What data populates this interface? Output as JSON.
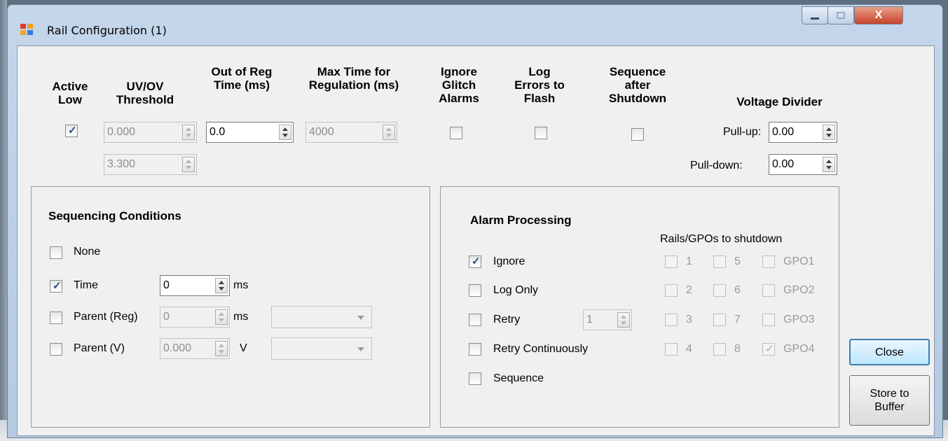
{
  "window": {
    "title": "Rail Configuration (1)",
    "close_glyph": "X"
  },
  "headers": {
    "active_low": "Active Low",
    "uv_ov": "UV/OV Threshold",
    "out_of_reg": "Out of Reg Time (ms)",
    "max_time": "Max Time for Regulation (ms)",
    "ignore_glitch": "Ignore Glitch Alarms",
    "log_errors": "Log Errors to Flash",
    "seq_after": "Sequence after Shutdown",
    "voltage_divider": "Voltage Divider"
  },
  "top_row": {
    "active_low_checked": true,
    "uv_value": "0.000",
    "ov_value": "3.300",
    "out_of_reg_value": "0.0",
    "max_time_value": "4000",
    "ignore_glitch_checked": false,
    "log_errors_checked": false,
    "seq_after_checked": false,
    "pullup_label": "Pull-up:",
    "pullup_value": "0.00",
    "pulldown_label": "Pull-down:",
    "pulldown_value": "0.00"
  },
  "sequencing": {
    "title": "Sequencing Conditions",
    "none_label": "None",
    "time_label": "Time",
    "time_value": "0",
    "time_unit": "ms",
    "parent_reg_label": "Parent (Reg)",
    "parent_reg_value": "0",
    "parent_reg_unit": "ms",
    "parent_v_label": "Parent (V)",
    "parent_v_value": "0.000",
    "parent_v_unit": "V"
  },
  "alarm": {
    "title": "Alarm Processing",
    "rails_header": "Rails/GPOs to shutdown",
    "ignore_label": "Ignore",
    "log_only_label": "Log Only",
    "retry_label": "Retry",
    "retry_value": "1",
    "retry_cont_label": "Retry Continuously",
    "sequence_label": "Sequence",
    "rails": [
      "1",
      "5",
      "GPO1",
      "2",
      "6",
      "GPO2",
      "3",
      "7",
      "GPO3",
      "4",
      "8",
      "GPO4"
    ]
  },
  "buttons": {
    "close": "Close",
    "store": "Store to Buffer"
  },
  "icons": {
    "check": "✓"
  }
}
